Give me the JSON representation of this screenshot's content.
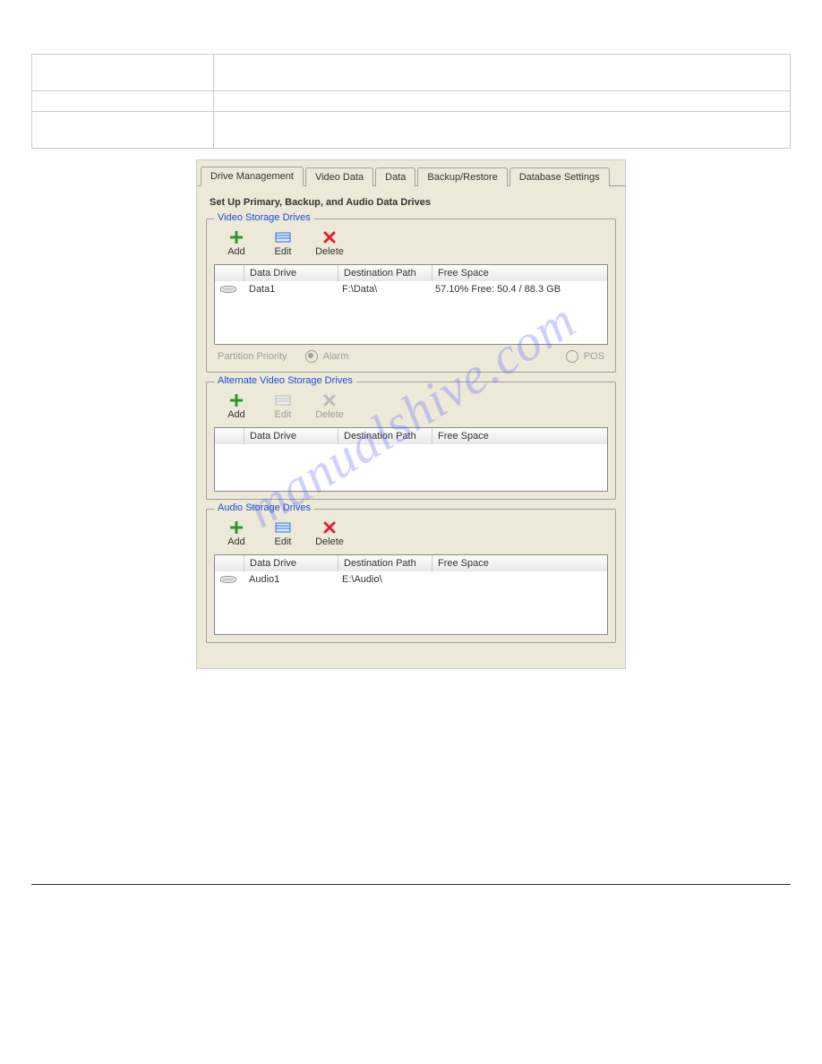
{
  "tabs": {
    "active": "Drive Management",
    "t0": "Drive Management",
    "t1": "Video Data",
    "t2": "Data",
    "t3": "Backup/Restore",
    "t4": "Database Settings"
  },
  "panel_title": "Set Up Primary, Backup, and Audio Data Drives",
  "groups": {
    "video": {
      "legend": "Video Storage Drives",
      "toolbar": {
        "add": "Add",
        "edit": "Edit",
        "delete": "Delete"
      },
      "headers": {
        "drive": "Data Drive",
        "path": "Destination Path",
        "free": "Free Space"
      },
      "rows": [
        {
          "drive": "Data1",
          "path": "F:\\Data\\",
          "free": "57.10% Free: 50.4 / 88.3 GB"
        }
      ],
      "partition_priority_label": "Partition Priority",
      "alarm_label": "Alarm",
      "pos_label": "POS"
    },
    "alt": {
      "legend": "Alternate Video Storage Drives",
      "toolbar": {
        "add": "Add",
        "edit": "Edit",
        "delete": "Delete"
      },
      "headers": {
        "drive": "Data Drive",
        "path": "Destination Path",
        "free": "Free Space"
      },
      "rows": []
    },
    "audio": {
      "legend": "Audio Storage Drives",
      "toolbar": {
        "add": "Add",
        "edit": "Edit",
        "delete": "Delete"
      },
      "headers": {
        "drive": "Data Drive",
        "path": "Destination Path",
        "free": "Free Space"
      },
      "rows": [
        {
          "drive": "Audio1",
          "path": "E:\\Audio\\",
          "free": ""
        }
      ]
    }
  },
  "watermark": "manualshive.com"
}
